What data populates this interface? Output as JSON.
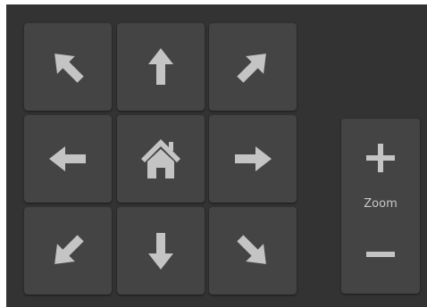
{
  "colors": {
    "background": "#333333",
    "button": "#444444",
    "icon": "#c4c4c4",
    "label": "#c8c8c8"
  },
  "pan_controls": {
    "icons": [
      "arrow-up-left-icon",
      "arrow-up-icon",
      "arrow-up-right-icon",
      "arrow-left-icon",
      "home-icon",
      "arrow-right-icon",
      "arrow-down-left-icon",
      "arrow-down-icon",
      "arrow-down-right-icon"
    ]
  },
  "zoom": {
    "label": "Zoom",
    "icons": [
      "plus-icon",
      "minus-icon"
    ]
  }
}
